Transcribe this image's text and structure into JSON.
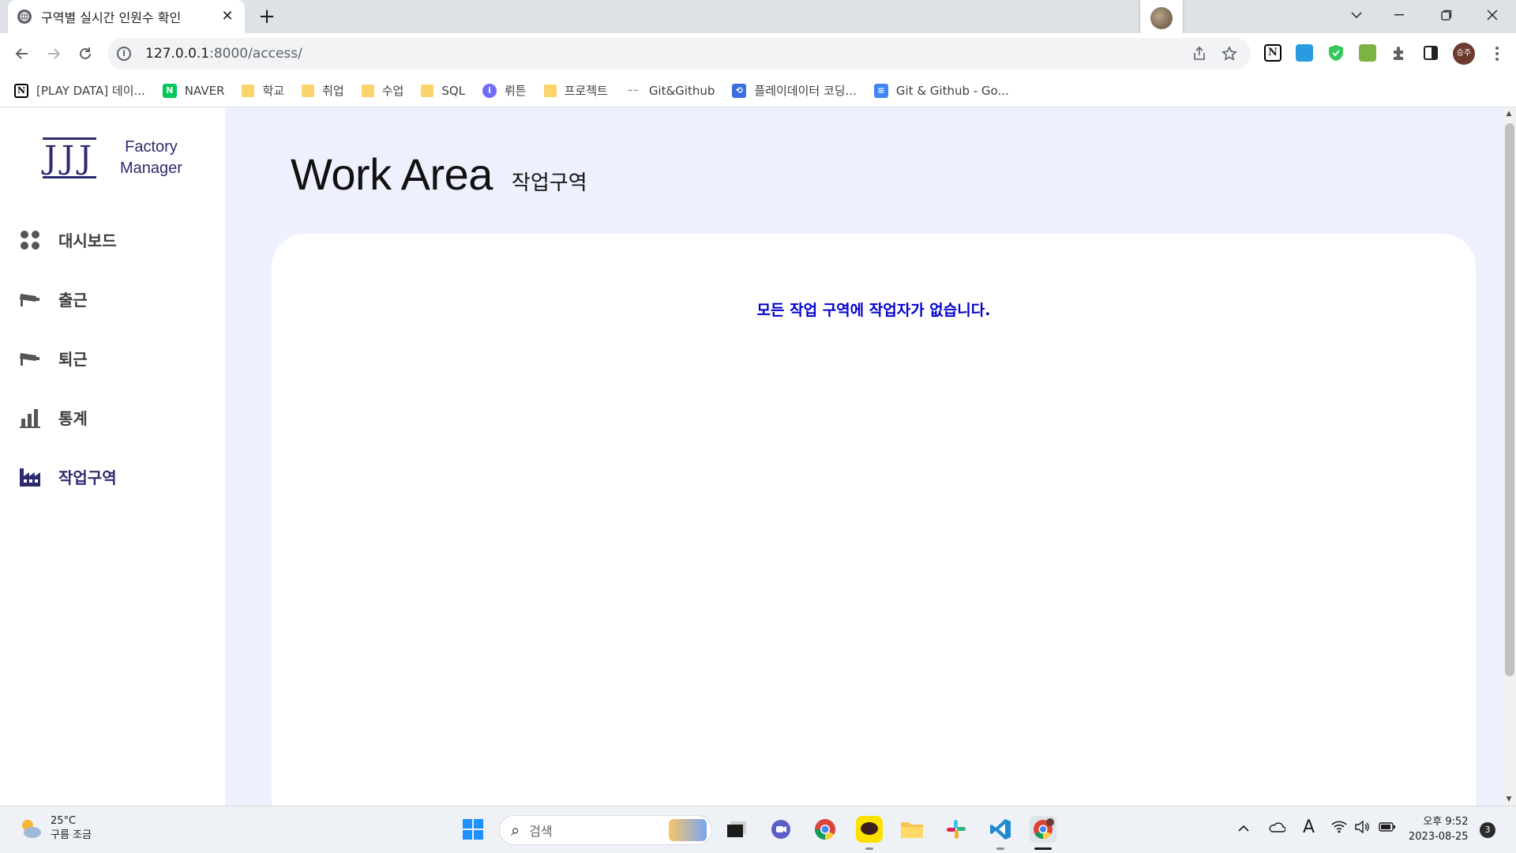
{
  "browser": {
    "tab_title": "구역별 실시간 인원수 확인",
    "tab_close": "✕",
    "new_tab": "+",
    "url_host": "127.0.0.1",
    "url_path": ":8000/access/",
    "profile_initials": "승주"
  },
  "bookmarks": [
    {
      "label": "[PLAY DATA] 데이...",
      "icon": "notion-icon"
    },
    {
      "label": "NAVER",
      "icon": "naver-icon"
    },
    {
      "label": "학교",
      "icon": "folder-icon"
    },
    {
      "label": "취업",
      "icon": "folder-icon"
    },
    {
      "label": "수업",
      "icon": "folder-icon"
    },
    {
      "label": "SQL",
      "icon": "folder-icon"
    },
    {
      "label": "뤼튼",
      "icon": "wrtn-icon"
    },
    {
      "label": "프로젝트",
      "icon": "folder-icon"
    },
    {
      "label": "Git&Github",
      "icon": "git-icon"
    },
    {
      "label": "플레이데이터 코딩...",
      "icon": "playdata-icon"
    },
    {
      "label": "Git & Github - Go...",
      "icon": "google-docs-icon"
    }
  ],
  "app": {
    "logo_letters": "JJJ",
    "logo_line1": "Factory",
    "logo_line2": "Manager",
    "menu": [
      {
        "label": "대시보드",
        "icon": "dashboard-icon"
      },
      {
        "label": "출근",
        "icon": "cctv-icon"
      },
      {
        "label": "퇴근",
        "icon": "cctv-icon"
      },
      {
        "label": "통계",
        "icon": "bar-chart-icon"
      },
      {
        "label": "작업구역",
        "icon": "factory-icon",
        "active": true
      }
    ],
    "page_title": "Work Area",
    "page_subtitle": "작업구역",
    "empty_message": "모든 작업 구역에 작업자가 없습니다."
  },
  "taskbar": {
    "temperature": "25°C",
    "weather_desc": "구름 조금",
    "search_placeholder": "검색",
    "time": "오후 9:52",
    "date": "2023-08-25",
    "notification_count": "3",
    "ime_indicator": "A"
  },
  "colors": {
    "brand_navy": "#2c2b6f",
    "message_blue": "#0000cd",
    "page_bg": "#eef0fd"
  }
}
